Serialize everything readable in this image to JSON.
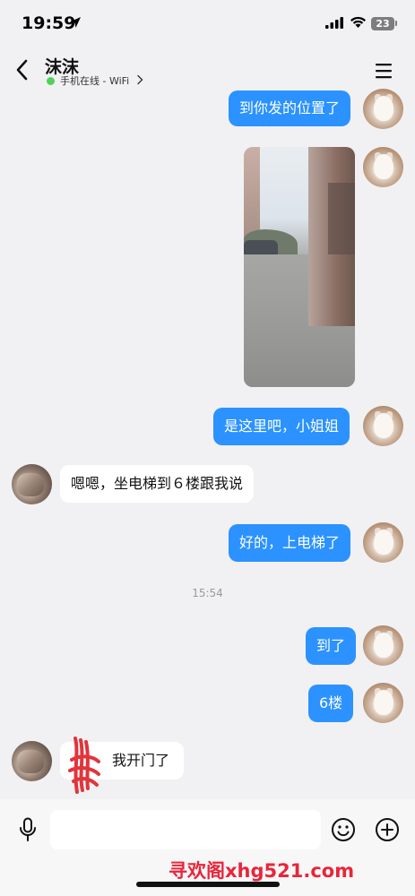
{
  "status_bar": {
    "time": "19:59",
    "battery": "23"
  },
  "header": {
    "contact_name": "沫沫",
    "online_status": "手机在线 - WiFi"
  },
  "messages": [
    {
      "from": "me",
      "type": "text",
      "text": "到你发的位置了"
    },
    {
      "from": "me",
      "type": "image"
    },
    {
      "from": "me",
      "type": "text",
      "text": "是这里吧，小姐姐"
    },
    {
      "from": "her",
      "type": "text",
      "text": "嗯嗯，坐电梯到６楼跟我说"
    },
    {
      "from": "me",
      "type": "text",
      "text": "好的，上电梯了"
    },
    {
      "from": "me",
      "type": "text",
      "text": "到了"
    },
    {
      "from": "me",
      "type": "text",
      "text": "6楼"
    },
    {
      "from": "her",
      "type": "text",
      "text": "我开门了"
    }
  ],
  "timestamp": "15:54",
  "input": {
    "placeholder": ""
  },
  "watermark": "寻欢阁xhg521.com",
  "colors": {
    "bubble_me": "#2b92ff",
    "bubble_her": "#ffffff",
    "background": "#f1f1f3",
    "online": "#4fd45a",
    "watermark": "#e8263a"
  }
}
